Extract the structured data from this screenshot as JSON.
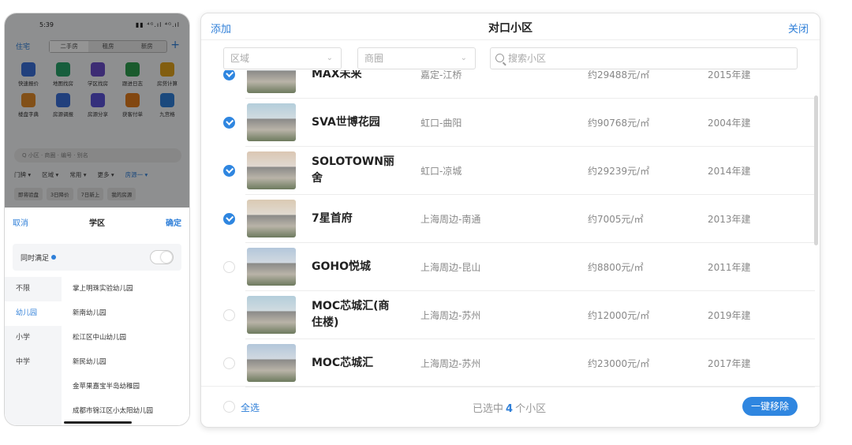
{
  "phone": {
    "status": {
      "time": "5:39",
      "signal": "▮▮ ⁴ᴳ.ıl ⁴ᴳ.ıl"
    },
    "nav": {
      "home": "住宅",
      "tabs": [
        "二手房",
        "租房",
        "新房"
      ],
      "active_tab": 0,
      "plus": "+"
    },
    "icons": [
      {
        "label": "快速报价",
        "icon": "lightning-icon",
        "color": "#3a6fd8"
      },
      {
        "label": "地图找房",
        "icon": "map-pin-icon",
        "color": "#29a36a"
      },
      {
        "label": "学区找房",
        "icon": "graduation-cap-icon",
        "color": "#6a4cc9"
      },
      {
        "label": "跟进日志",
        "icon": "log-icon",
        "color": "#2e9d4e"
      },
      {
        "label": "房贷计算",
        "icon": "calculator-icon",
        "color": "#e0a21c"
      },
      {
        "label": "楼盘字典",
        "icon": "building-book-icon",
        "color": "#e08a2a"
      },
      {
        "label": "房源调报",
        "icon": "report-icon",
        "color": "#3a6fd8"
      },
      {
        "label": "房源分享",
        "icon": "share-icon",
        "color": "#5a52d6"
      },
      {
        "label": "获客付单",
        "icon": "trophy-icon",
        "color": "#e07a1c"
      },
      {
        "label": "九宫格",
        "icon": "grid-icon",
        "color": "#2f7fd8"
      }
    ],
    "search_placeholder": "Q 小区 · 商圈 · 编号 · 别名",
    "filters": [
      "门牌 ▾",
      "区域 ▾",
      "常用 ▾",
      "更多 ▾",
      "房源一 ▾"
    ],
    "chips": [
      "即将验盘",
      "3日降价",
      "7日新上",
      "我的房源"
    ],
    "sheet": {
      "cancel": "取消",
      "title": "学区",
      "confirm": "确定",
      "same_time": "同时满足",
      "levels": [
        "不限",
        "幼儿园",
        "小学",
        "中学"
      ],
      "active_level": 1,
      "schools": [
        "掌上明珠实验幼儿园",
        "新南幼儿园",
        "松江区中山幼儿园",
        "新民幼儿园",
        "金苹果嘉宝半岛幼稚园",
        "成都市锦江区小太阳幼儿园"
      ]
    }
  },
  "modal": {
    "add": "添加",
    "title": "对口小区",
    "close": "关闭",
    "filter_district": "区域",
    "filter_business": "商圈",
    "search_placeholder": "搜索小区",
    "communities": [
      {
        "name": "MAX未来",
        "area": "嘉定-江桥",
        "price": "约29488元/㎡",
        "year": "2015年建",
        "checked": true
      },
      {
        "name": "SVA世博花园",
        "area": "虹口-曲阳",
        "price": "约90768元/㎡",
        "year": "2004年建",
        "checked": true
      },
      {
        "name": "SOLOTOWN丽舍",
        "area": "虹口-凉城",
        "price": "约29239元/㎡",
        "year": "2014年建",
        "checked": true
      },
      {
        "name": "7星首府",
        "area": "上海周边-南通",
        "price": "约7005元/㎡",
        "year": "2013年建",
        "checked": true
      },
      {
        "name": "GOHO悦城",
        "area": "上海周边-昆山",
        "price": "约8800元/㎡",
        "year": "2011年建",
        "checked": false
      },
      {
        "name": "MOC芯城汇(商住楼)",
        "area": "上海周边-苏州",
        "price": "约12000元/㎡",
        "year": "2019年建",
        "checked": false
      },
      {
        "name": "MOC芯城汇",
        "area": "上海周边-苏州",
        "price": "约23000元/㎡",
        "year": "2017年建",
        "checked": false
      }
    ],
    "footer": {
      "select_all": "全选",
      "selected_prefix": "已选中",
      "selected_count": "4",
      "selected_suffix": "个小区",
      "remove_button": "一键移除"
    }
  }
}
